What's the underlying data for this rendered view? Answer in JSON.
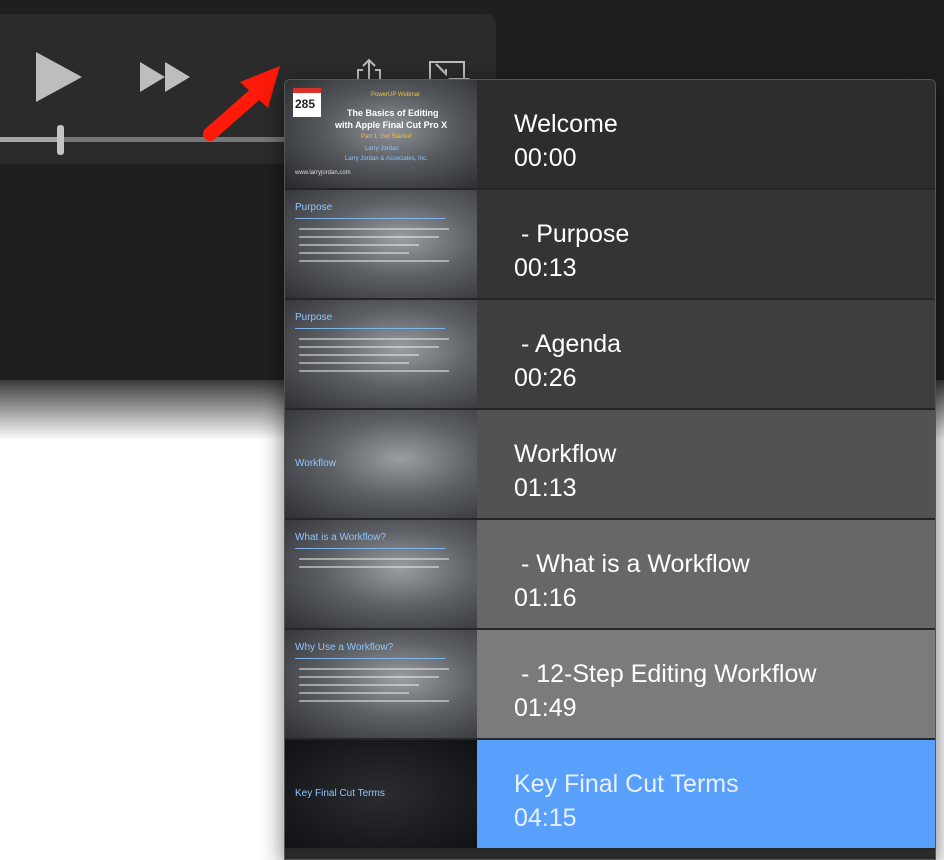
{
  "player": {
    "play_icon": "play-icon",
    "fast_forward_icon": "fast-forward-icon",
    "share_icon": "share-icon",
    "pip_icon": "picture-in-picture-icon",
    "progress": 0.2
  },
  "annotation": {
    "arrow_color": "#ff1a0a"
  },
  "colors": {
    "selected": "#58a0fc",
    "menu_bg": "#2a2a2a"
  },
  "chapters": [
    {
      "title": "Welcome",
      "time": "00:00",
      "thumb": {
        "badge": "285",
        "kicker": "PowerUP Webinar",
        "line1": "The Basics of Editing",
        "line2": "with Apple Final Cut Pro X",
        "part": "Part 1: Get Started",
        "presenter": "Larry Jordan",
        "company": "Larry Jordan & Associates, Inc.",
        "url": "www.larryjordan.com"
      }
    },
    {
      "title": " - Purpose",
      "time": "00:13",
      "thumb": {
        "heading": "Purpose"
      }
    },
    {
      "title": " - Agenda",
      "time": "00:26",
      "thumb": {
        "heading": "Purpose"
      }
    },
    {
      "title": "Workflow",
      "time": "01:13",
      "thumb": {
        "heading": "Workflow"
      }
    },
    {
      "title": " - What is a Workflow",
      "time": "01:16",
      "thumb": {
        "heading": "What is a Workflow?"
      }
    },
    {
      "title": " - 12-Step Editing Workflow",
      "time": "01:49",
      "thumb": {
        "heading": "Why Use a Workflow?"
      }
    },
    {
      "title": "Key Final Cut Terms",
      "time": "04:15",
      "thumb": {
        "heading": "Key Final Cut Terms"
      },
      "selected": true
    }
  ]
}
